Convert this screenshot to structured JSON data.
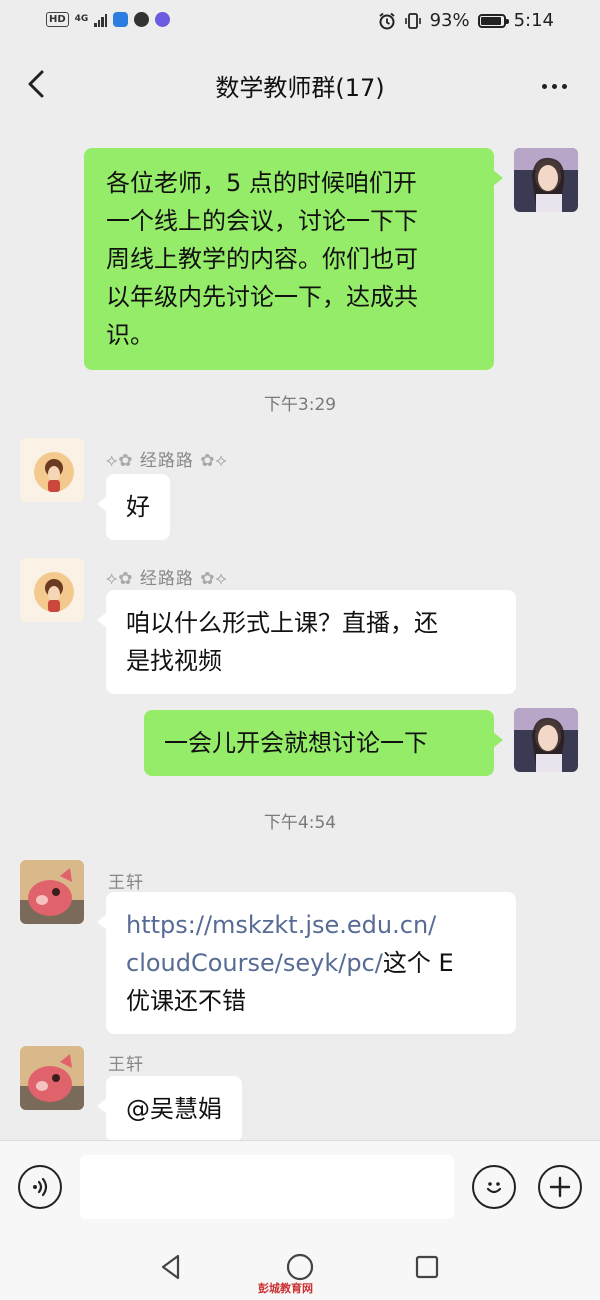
{
  "status_bar": {
    "hd": "HD",
    "network": "4G",
    "battery": "93%",
    "time": "5:14",
    "battery_level": 0.93
  },
  "header": {
    "title": "数学教师群(17)",
    "back_icon": "chevron-left-icon",
    "more_icon": "more-dots-icon"
  },
  "messages": [
    {
      "type": "outgoing",
      "lines": [
        "各位老师，5 点的时候咱们开",
        "一个线上的会议，讨论一下下",
        "周线上教学的内容。你们也可",
        "以年级内先讨论一下，达成共",
        "识。"
      ]
    },
    {
      "type": "time",
      "text": "下午3:29"
    },
    {
      "type": "incoming",
      "sender": "经路路",
      "text": "好"
    },
    {
      "type": "incoming",
      "sender": "经路路",
      "lines": [
        "咱以什么形式上课？直播，还",
        "是找视频"
      ]
    },
    {
      "type": "outgoing",
      "text": "一会儿开会就想讨论一下"
    },
    {
      "type": "time",
      "text": "下午4:54"
    },
    {
      "type": "incoming",
      "sender": "王轩",
      "link_line1": "https://mskzkt.jse.edu.cn/",
      "link_line2": "cloudCourse/seyk/pc/",
      "line2_tail": "这个 E",
      "line3": "优课还不错"
    },
    {
      "type": "incoming",
      "sender": "王轩",
      "text": "@吴慧娟"
    }
  ],
  "input_bar": {
    "placeholder": "",
    "voice_icon": "voice-icon",
    "emoji_icon": "emoji-icon",
    "plus_icon": "plus-icon"
  },
  "nav_bar": {
    "back_icon": "nav-back-icon",
    "home_icon": "nav-home-icon",
    "recent_icon": "nav-recent-icon",
    "watermark": "彭城教育网"
  }
}
